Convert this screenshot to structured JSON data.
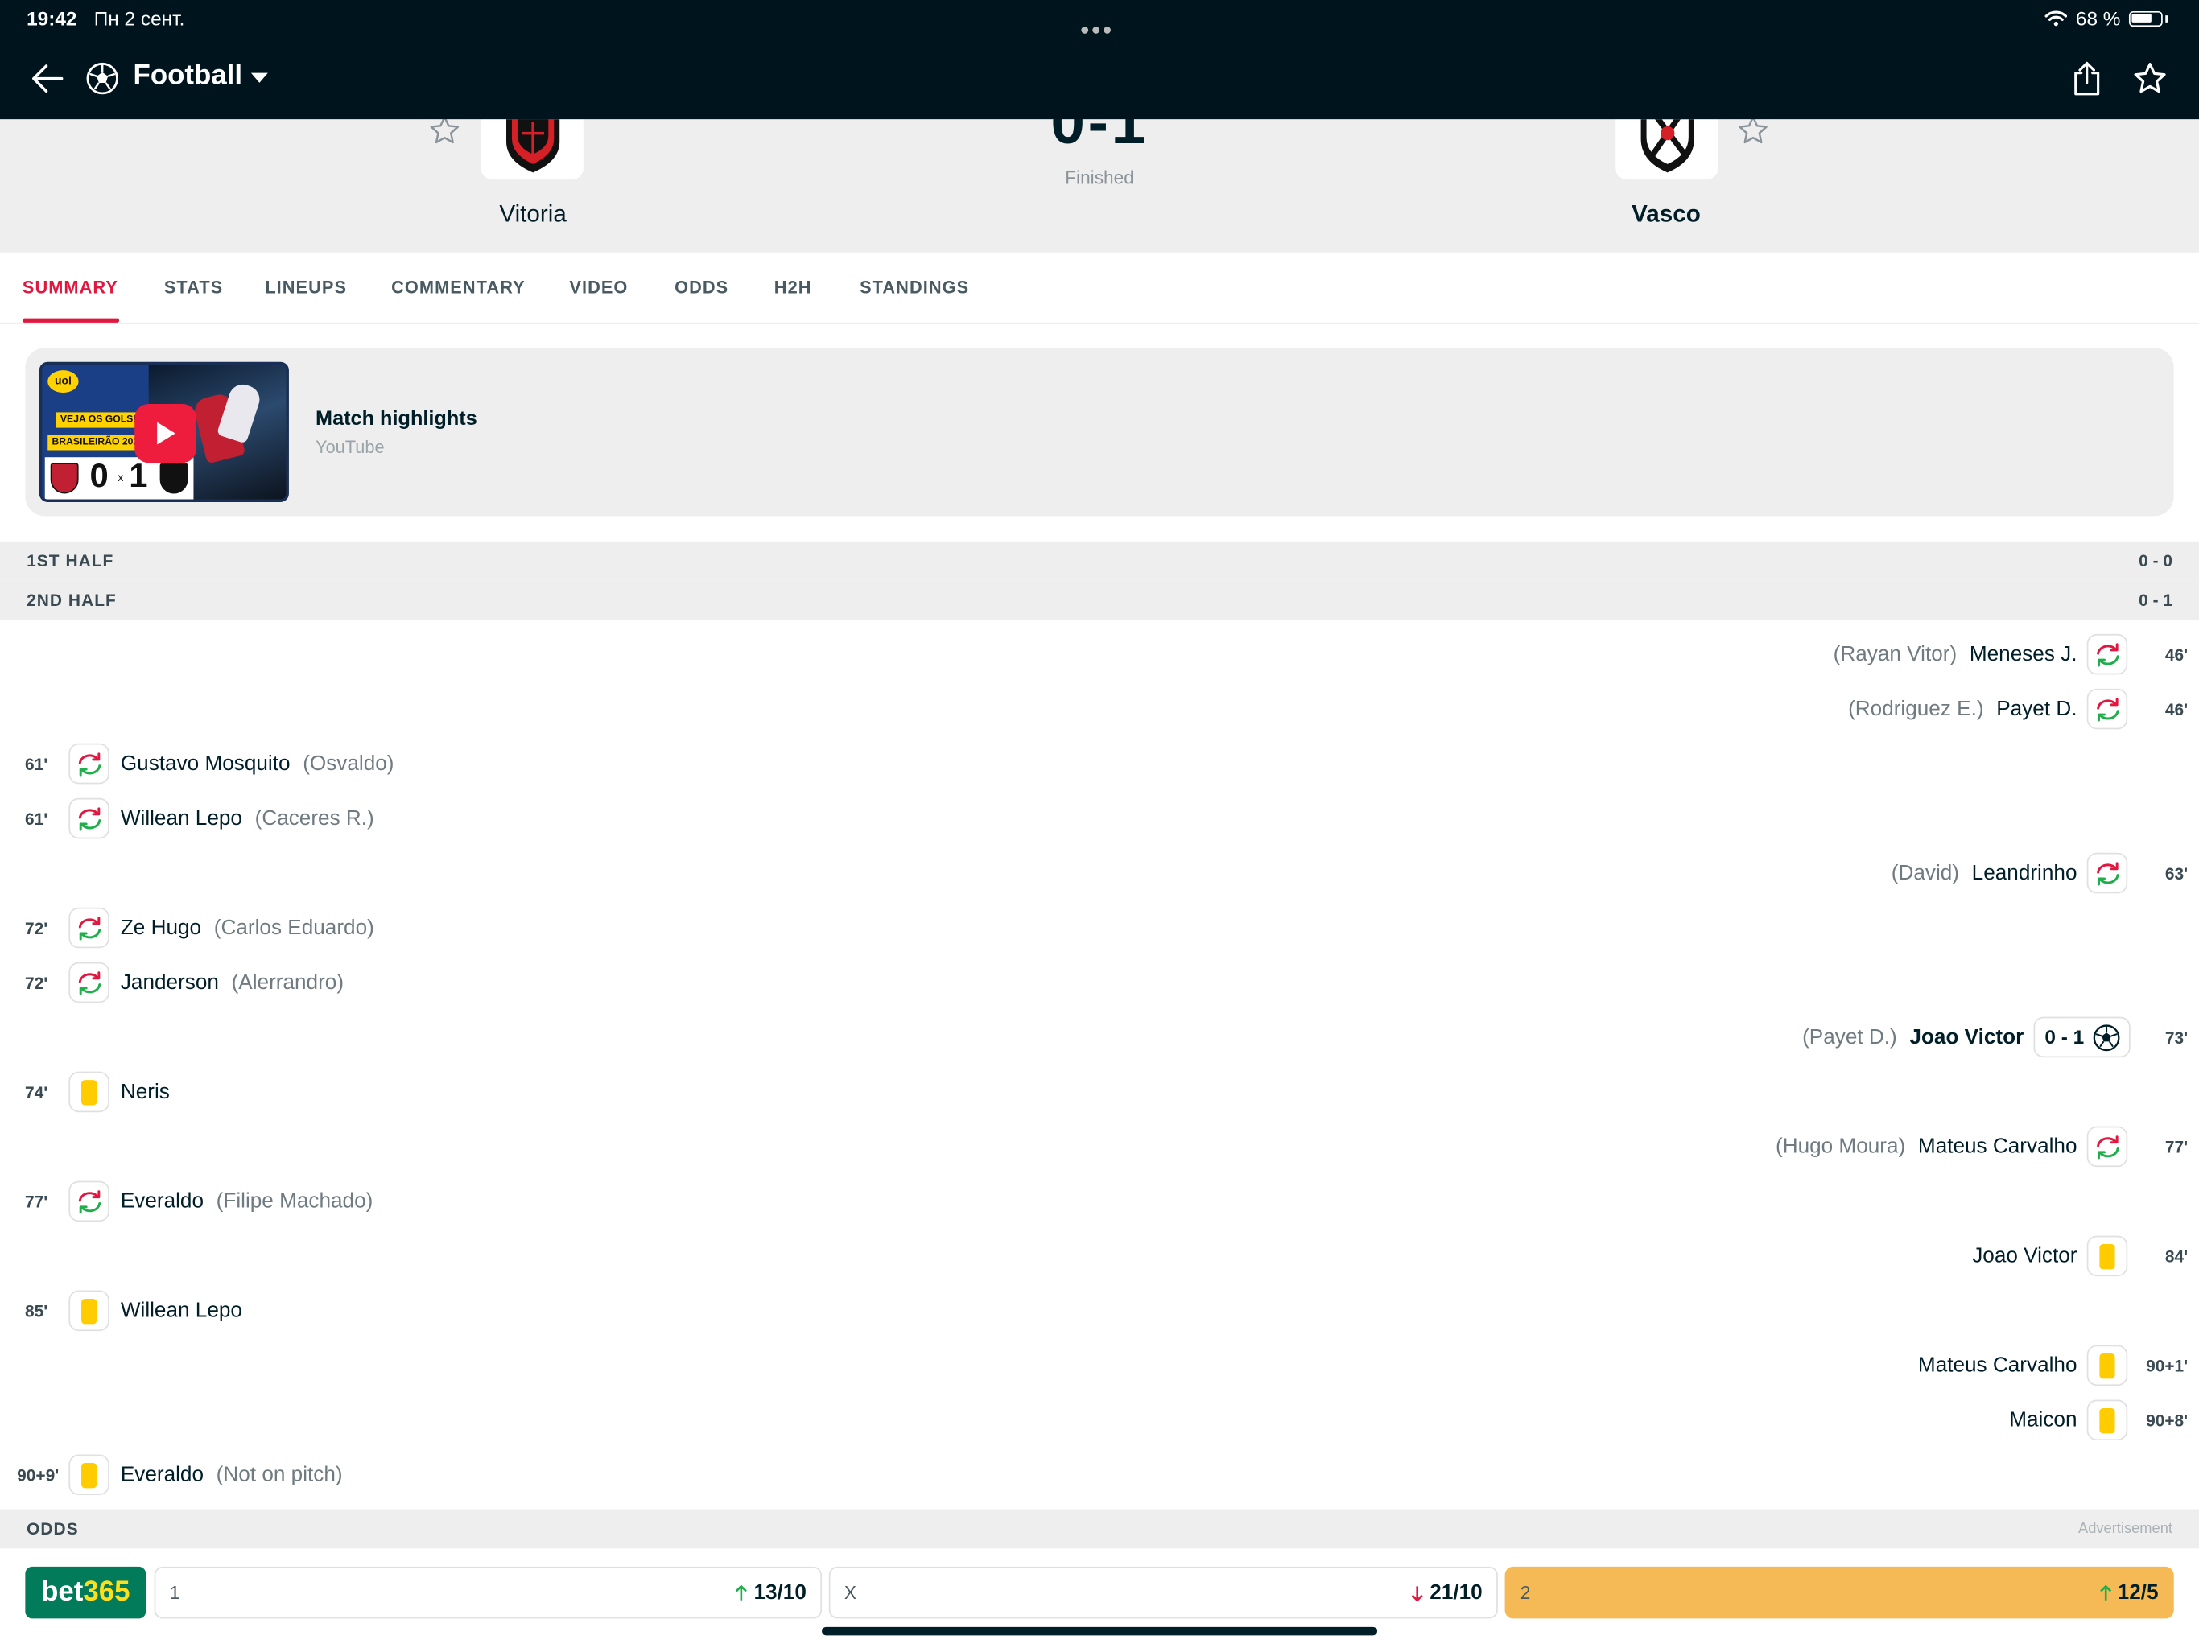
{
  "status_bar": {
    "time": "19:42",
    "date": "Пн 2 сент.",
    "battery": "68 %"
  },
  "top_bar": {
    "title": "Football",
    "icons": [
      "back-arrow-icon",
      "football-icon",
      "chevron-down-icon",
      "share-icon",
      "star-icon"
    ]
  },
  "match": {
    "home_team": "Vitoria",
    "away_team": "Vasco",
    "score": "0-1",
    "status": "Finished"
  },
  "tabs": [
    "SUMMARY",
    "STATS",
    "LINEUPS",
    "COMMENTARY",
    "VIDEO",
    "ODDS",
    "H2H",
    "STANDINGS"
  ],
  "active_tab": "SUMMARY",
  "highlights": {
    "title": "Match highlights",
    "source": "YouTube",
    "thumb": {
      "badge": "uol",
      "line1": "VEJA OS GOLS!",
      "line2": "BRASILEIRÃO 202",
      "score_home": "0",
      "sep": "x",
      "score_away": "1"
    }
  },
  "periods": [
    {
      "label": "1ST HALF",
      "score": "0 - 0"
    },
    {
      "label": "2ND HALF",
      "score": "0 - 1"
    }
  ],
  "incidents": [
    {
      "side": "away",
      "minute": "46'",
      "type": "sub",
      "player": "Meneses J.",
      "sub": "(Rayan Vitor)"
    },
    {
      "side": "away",
      "minute": "46'",
      "type": "sub",
      "player": "Payet D.",
      "sub": "(Rodriguez E.)"
    },
    {
      "side": "home",
      "minute": "61'",
      "type": "sub",
      "player": "Gustavo Mosquito",
      "sub": "(Osvaldo)"
    },
    {
      "side": "home",
      "minute": "61'",
      "type": "sub",
      "player": "Willean Lepo",
      "sub": "(Caceres R.)"
    },
    {
      "side": "away",
      "minute": "63'",
      "type": "sub",
      "player": "Leandrinho",
      "sub": "(David)"
    },
    {
      "side": "home",
      "minute": "72'",
      "type": "sub",
      "player": "Ze Hugo",
      "sub": "(Carlos Eduardo)"
    },
    {
      "side": "home",
      "minute": "72'",
      "type": "sub",
      "player": "Janderson",
      "sub": "(Alerrandro)"
    },
    {
      "side": "away",
      "minute": "73'",
      "type": "goal",
      "player": "Joao Victor",
      "sub": "(Payet D.)",
      "score": "0 - 1"
    },
    {
      "side": "home",
      "minute": "74'",
      "type": "yellow",
      "player": "Neris"
    },
    {
      "side": "away",
      "minute": "77'",
      "type": "sub",
      "player": "Mateus Carvalho",
      "sub": "(Hugo Moura)"
    },
    {
      "side": "home",
      "minute": "77'",
      "type": "sub",
      "player": "Everaldo",
      "sub": "(Filipe Machado)"
    },
    {
      "side": "away",
      "minute": "84'",
      "type": "yellow",
      "player": "Joao Victor"
    },
    {
      "side": "home",
      "minute": "85'",
      "type": "yellow",
      "player": "Willean Lepo"
    },
    {
      "side": "away",
      "minute": "90+1'",
      "type": "yellow",
      "player": "Mateus Carvalho"
    },
    {
      "side": "away",
      "minute": "90+8'",
      "type": "yellow",
      "player": "Maicon"
    },
    {
      "side": "home",
      "minute": "90+9'",
      "type": "yellow",
      "player": "Everaldo",
      "sub": "(Not on pitch)"
    }
  ],
  "odds": {
    "label": "ODDS",
    "ad_label": "Advertisement",
    "bookmaker": {
      "part1": "bet",
      "part2": "365"
    },
    "items": [
      {
        "label": "1",
        "value": "13/10",
        "trend": "up",
        "selected": false
      },
      {
        "label": "X",
        "value": "21/10",
        "trend": "down",
        "selected": false
      },
      {
        "label": "2",
        "value": "12/5",
        "trend": "up",
        "selected": true
      }
    ]
  },
  "colors": {
    "accent": "#e0173f",
    "topbar": "#00141e",
    "yellow_card": "#ffcc00",
    "sub_in": "#1fae4b",
    "sub_out": "#e0173f",
    "odds_selected": "#f5b956",
    "bookmaker_green": "#027b5b"
  }
}
